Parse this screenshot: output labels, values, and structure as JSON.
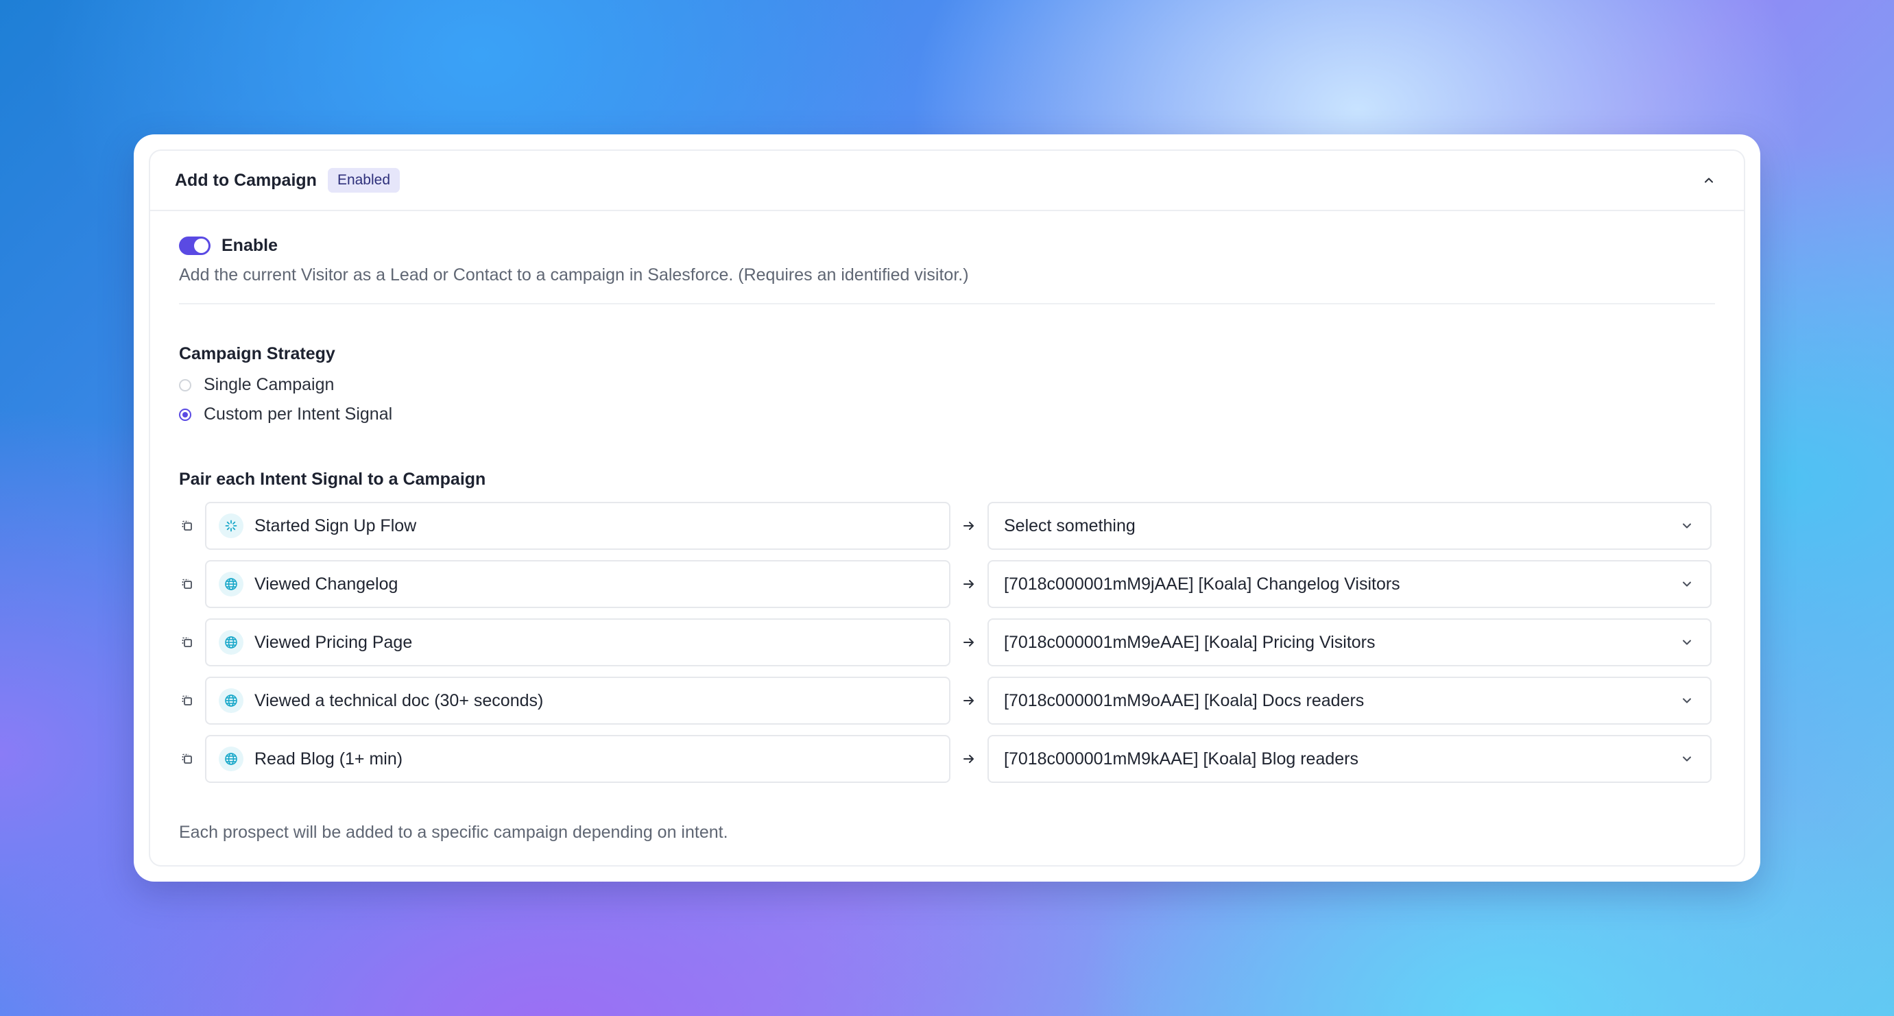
{
  "panel": {
    "title": "Add to Campaign",
    "status_badge": "Enabled"
  },
  "enable": {
    "label": "Enable",
    "enabled": true,
    "description": "Add the current Visitor as a Lead or Contact to a campaign in Salesforce. (Requires an identified visitor.)"
  },
  "strategy": {
    "heading": "Campaign Strategy",
    "options": [
      {
        "label": "Single Campaign",
        "selected": false
      },
      {
        "label": "Custom per Intent Signal",
        "selected": true
      }
    ]
  },
  "pairing": {
    "heading": "Pair each Intent Signal to a Campaign",
    "rows": [
      {
        "signal": "Started Sign Up Flow",
        "icon": "sparkle-icon",
        "campaign": "Select something"
      },
      {
        "signal": "Viewed Changelog",
        "icon": "globe-icon",
        "campaign": "[7018c000001mM9jAAE] [Koala] Changelog Visitors"
      },
      {
        "signal": "Viewed Pricing Page",
        "icon": "globe-icon",
        "campaign": "[7018c000001mM9eAAE] [Koala] Pricing Visitors"
      },
      {
        "signal": "Viewed a technical doc (30+ seconds)",
        "icon": "globe-icon",
        "campaign": "[7018c000001mM9oAAE] [Koala] Docs readers"
      },
      {
        "signal": "Read Blog (1+ min)",
        "icon": "globe-icon",
        "campaign": "[7018c000001mM9kAAE] [Koala] Blog readers"
      }
    ]
  },
  "footer_note": "Each prospect will be added to a specific campaign depending on intent.",
  "colors": {
    "accent": "#5a4ae3",
    "icon_teal": "#17a7c9",
    "badge_bg": "#e6e6fa"
  }
}
